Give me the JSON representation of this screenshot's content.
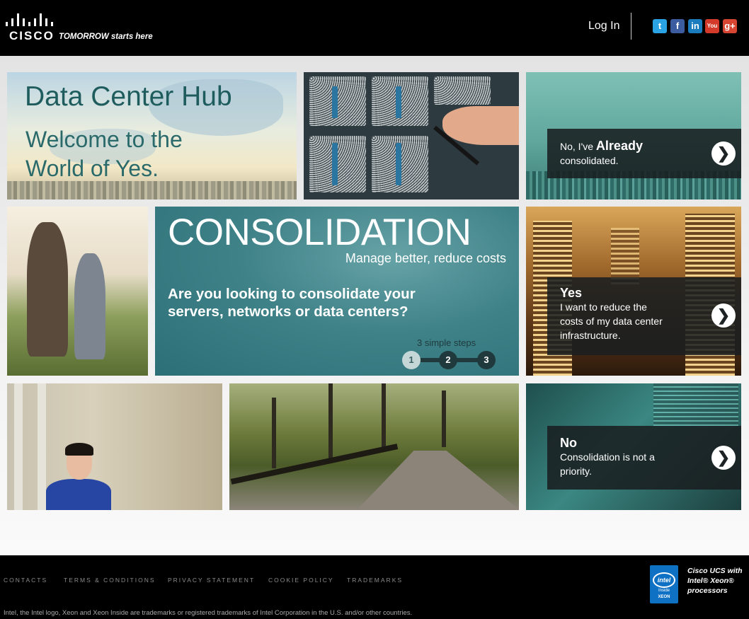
{
  "header": {
    "tagline": "TOMORROW starts here",
    "brand": "CISCO",
    "login": "Log In",
    "social": [
      {
        "name": "twitter-icon",
        "glyph": "t",
        "color": "#2aa3e4"
      },
      {
        "name": "facebook-icon",
        "glyph": "f",
        "color": "#3b5c9f"
      },
      {
        "name": "linkedin-icon",
        "glyph": "in",
        "color": "#1a7bbd"
      },
      {
        "name": "youtube-icon",
        "glyph": "You",
        "color": "#d43a2a"
      },
      {
        "name": "googleplus-icon",
        "glyph": "g+",
        "color": "#d54531"
      }
    ]
  },
  "hero": {
    "title": "Data Center Hub",
    "welcome_line1": "Welcome to the",
    "welcome_line2": "World of Yes."
  },
  "already": {
    "prefix": "No, I've ",
    "bold": "Already",
    "line2": "consolidated."
  },
  "consolidation": {
    "title": "CONSOLIDATION",
    "subtitle": "Manage better, reduce costs",
    "question_line1": "Are you looking to consolidate your",
    "question_line2": "servers, networks or data centers?",
    "steps_label": "3 simple steps",
    "steps": [
      "1",
      "2",
      "3"
    ]
  },
  "yes": {
    "title": "Yes",
    "line1": "I want to reduce the",
    "line2": "costs of my data center",
    "line3": "infrastructure."
  },
  "no": {
    "title": "No",
    "line1": "Consolidation is not a",
    "line2": "priority."
  },
  "arrow_glyph": "❯",
  "footer": {
    "links": [
      "CONTACTS",
      "TERMS & CONDITIONS",
      "PRIVACY STATEMENT",
      "COOKIE POLICY",
      "TRADEMARKS"
    ],
    "intel_logo": "intel",
    "intel_inside": "Inside",
    "intel_xeon": "XEON",
    "intel_line1": "Cisco UCS with",
    "intel_line2": "Intel® Xeon®",
    "intel_line3": "processors",
    "legal": "Intel, the Intel logo, Xeon and Xeon Inside are trademarks or registered trademarks of Intel Corporation in the U.S. and/or other countries."
  }
}
